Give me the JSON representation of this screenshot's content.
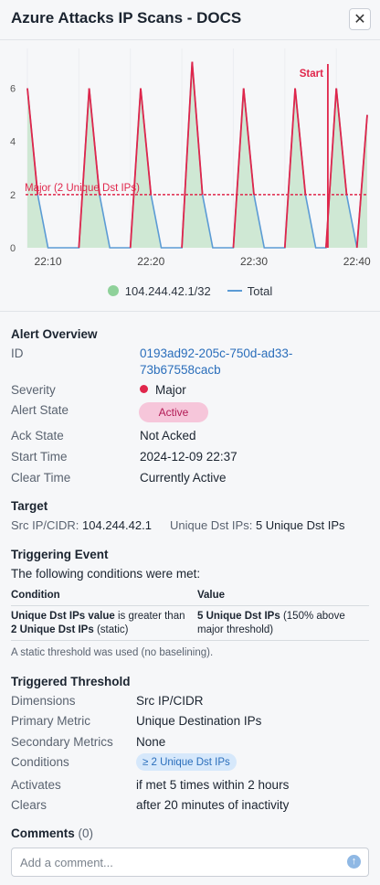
{
  "header": {
    "title": "Azure Attacks IP Scans - DOCS",
    "close_icon": "close-icon"
  },
  "chart_data": {
    "type": "area",
    "x": [
      "22:08",
      "22:09",
      "22:10",
      "22:11",
      "22:12",
      "22:13",
      "22:14",
      "22:15",
      "22:16",
      "22:17",
      "22:18",
      "22:19",
      "22:20",
      "22:21",
      "22:22",
      "22:23",
      "22:24",
      "22:25",
      "22:26",
      "22:27",
      "22:28",
      "22:29",
      "22:30",
      "22:31",
      "22:32",
      "22:33",
      "22:34",
      "22:35",
      "22:36",
      "22:37",
      "22:38",
      "22:39",
      "22:40",
      "22:41"
    ],
    "x_tick_labels": [
      "22:10",
      "22:20",
      "22:30",
      "22:40"
    ],
    "y_tick_labels": [
      "0",
      "2",
      "4",
      "6"
    ],
    "ylim": [
      0,
      7.5
    ],
    "series": [
      {
        "name": "104.244.42.1/32",
        "kind": "area",
        "color": "#cfe8d4",
        "values": [
          6,
          2,
          0,
          0,
          0,
          0,
          6,
          2,
          0,
          0,
          0,
          6,
          2,
          0,
          0,
          0,
          7,
          2,
          0,
          0,
          0,
          6,
          2,
          0,
          0,
          0,
          6,
          2,
          0,
          0,
          6,
          2,
          0,
          5
        ]
      },
      {
        "name": "Total",
        "kind": "line",
        "color": "#5b9bd5",
        "values": [
          6,
          2,
          0,
          0,
          0,
          0,
          6,
          2,
          0,
          0,
          0,
          6,
          2,
          0,
          0,
          0,
          7,
          2,
          0,
          0,
          0,
          6,
          2,
          0,
          0,
          0,
          6,
          2,
          0,
          0,
          6,
          2,
          0,
          5
        ]
      }
    ],
    "peak_color": "#e0264b",
    "threshold": {
      "value": 2,
      "label": "Major (2 Unique Dst IPs)",
      "color": "#e0264b"
    },
    "marker": {
      "x": "22:37",
      "label": "Start",
      "color": "#e0264b"
    },
    "grid": "vertical",
    "legend_position": "bottom"
  },
  "legend": {
    "area_label": "104.244.42.1/32",
    "line_label": "Total"
  },
  "overview": {
    "title": "Alert Overview",
    "id_label": "ID",
    "id_line1": "0193ad92-205c-750d-ad33-",
    "id_line2": "73b67558cacb",
    "severity_label": "Severity",
    "severity_value": "Major",
    "severity_color": "#e0264b",
    "state_label": "Alert State",
    "state_value": "Active",
    "ack_label": "Ack State",
    "ack_value": "Not Acked",
    "start_label": "Start Time",
    "start_value": "2024-12-09 22:37",
    "clear_label": "Clear Time",
    "clear_value": "Currently Active"
  },
  "target": {
    "title": "Target",
    "src_label": "Src IP/CIDR:",
    "src_value": "104.244.42.1",
    "dst_label": "Unique Dst IPs:",
    "dst_value": "5 Unique Dst IPs"
  },
  "triggering": {
    "title": "Triggering Event",
    "intro": "The following conditions were met:",
    "col_condition": "Condition",
    "col_value": "Value",
    "cond_bold1": "Unique Dst IPs value",
    "cond_text1": "is greater than",
    "cond_bold2": "2 Unique Dst IPs",
    "cond_text2": "(static)",
    "value_bold": "5 Unique Dst IPs",
    "value_text1": "(150% above",
    "value_text2": "major threshold)",
    "note": "A static threshold was used (no baselining)."
  },
  "threshold": {
    "title": "Triggered Threshold",
    "dimensions_label": "Dimensions",
    "dimensions_value": "Src IP/CIDR",
    "primary_label": "Primary Metric",
    "primary_value": "Unique Destination IPs",
    "secondary_label": "Secondary Metrics",
    "secondary_value": "None",
    "conditions_label": "Conditions",
    "conditions_value": "≥ 2 Unique Dst IPs",
    "activates_label": "Activates",
    "activates_value": "if met 5 times within 2 hours",
    "clears_label": "Clears",
    "clears_value": "after 20 minutes of inactivity"
  },
  "comments": {
    "title": "Comments",
    "count": "(0)",
    "placeholder": "Add a comment...",
    "send_icon": "send-icon"
  }
}
